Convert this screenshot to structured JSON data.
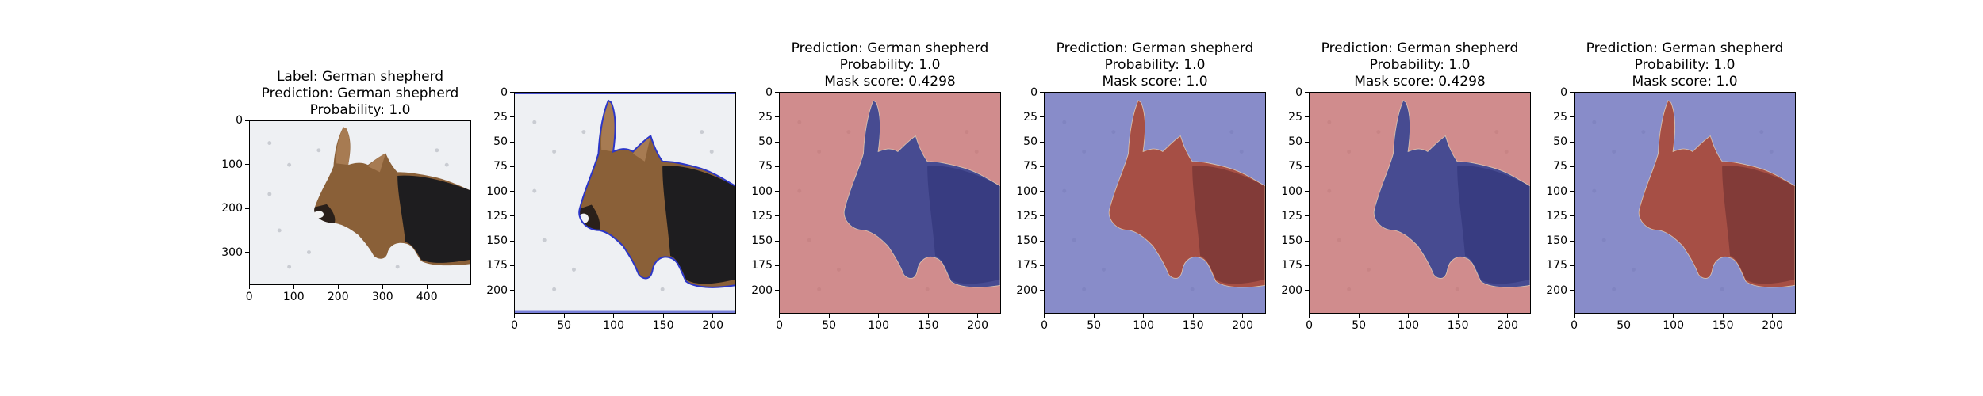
{
  "panels": [
    {
      "id": "p1",
      "title_lines": [
        "Label: German shepherd",
        "Prediction: German shepherd",
        "Probability: 1.0"
      ],
      "image_size": [
        500,
        375
      ],
      "xticks": [
        "0",
        "100",
        "200",
        "300",
        "400"
      ],
      "yticks": [
        "0",
        "100",
        "200",
        "300"
      ],
      "overlay": "none"
    },
    {
      "id": "p2",
      "title_lines": [],
      "image_size": [
        224,
        224
      ],
      "xticks": [
        "0",
        "50",
        "100",
        "150",
        "200"
      ],
      "yticks": [
        "0",
        "25",
        "50",
        "75",
        "100",
        "125",
        "150",
        "175",
        "200"
      ],
      "overlay": "contour"
    },
    {
      "id": "p3",
      "title_lines": [
        "Prediction: German shepherd",
        "Probability: 1.0",
        "Mask score: 0.4298"
      ],
      "image_size": [
        224,
        224
      ],
      "xticks": [
        "0",
        "50",
        "100",
        "150",
        "200"
      ],
      "yticks": [
        "0",
        "25",
        "50",
        "75",
        "100",
        "125",
        "150",
        "175",
        "200"
      ],
      "overlay": "red-bg-blue-dog"
    },
    {
      "id": "p4",
      "title_lines": [
        "Prediction: German shepherd",
        "Probability: 1.0",
        "Mask score: 1.0"
      ],
      "image_size": [
        224,
        224
      ],
      "xticks": [
        "0",
        "50",
        "100",
        "150",
        "200"
      ],
      "yticks": [
        "0",
        "25",
        "50",
        "75",
        "100",
        "125",
        "150",
        "175",
        "200"
      ],
      "overlay": "blue-bg-red-dog"
    },
    {
      "id": "p5",
      "title_lines": [
        "Prediction: German shepherd",
        "Probability: 1.0",
        "Mask score: 0.4298"
      ],
      "image_size": [
        224,
        224
      ],
      "xticks": [
        "0",
        "50",
        "100",
        "150",
        "200"
      ],
      "yticks": [
        "0",
        "25",
        "50",
        "75",
        "100",
        "125",
        "150",
        "175",
        "200"
      ],
      "overlay": "red-bg-blue-dog"
    },
    {
      "id": "p6",
      "title_lines": [
        "Prediction: German shepherd",
        "Probability: 1.0",
        "Mask score: 1.0"
      ],
      "image_size": [
        224,
        224
      ],
      "xticks": [
        "0",
        "50",
        "100",
        "150",
        "200"
      ],
      "yticks": [
        "0",
        "25",
        "50",
        "75",
        "100",
        "125",
        "150",
        "175",
        "200"
      ],
      "overlay": "blue-bg-red-dog"
    }
  ],
  "colors": {
    "snow": "#eef0f3",
    "mask_red": "#c87070",
    "mask_blue": "#6b70bd",
    "contour": "#2b36c8"
  }
}
